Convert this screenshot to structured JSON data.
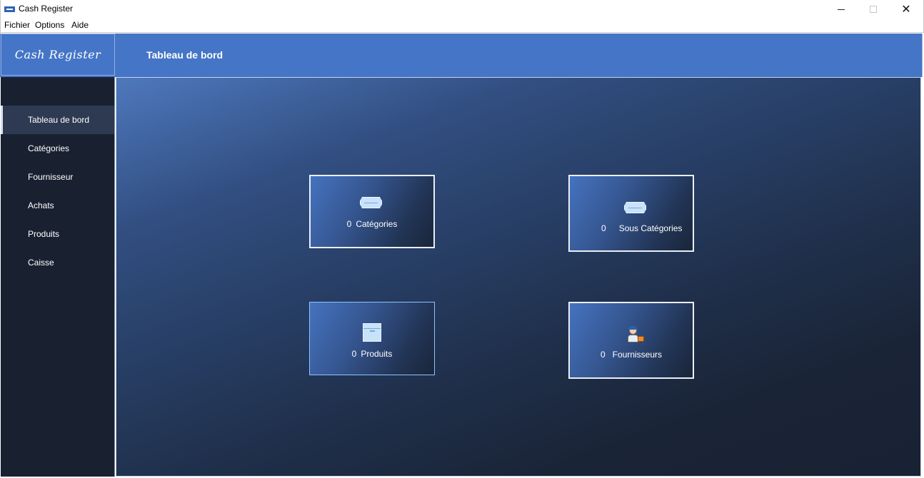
{
  "window": {
    "title": "Cash Register",
    "close_glyph": "✕"
  },
  "menu": [
    "Fichier",
    "Options",
    "Aide"
  ],
  "header": {
    "logo": "Cash Register",
    "page_title": "Tableau de bord"
  },
  "sidebar": {
    "items": [
      {
        "label": "Tableau de bord",
        "active": true
      },
      {
        "label": "Catégories"
      },
      {
        "label": "Fournisseur"
      },
      {
        "label": "Achats"
      },
      {
        "label": "Produits"
      },
      {
        "label": "Caisse"
      }
    ]
  },
  "tiles": {
    "categories": {
      "count": "0",
      "label": "Catégories",
      "icon": "ticket-icon"
    },
    "sous_categories": {
      "count": "0",
      "label": "Sous Catégories",
      "icon": "ticket-icon"
    },
    "produits": {
      "count": "0",
      "label": "Produits",
      "icon": "box-icon"
    },
    "fournisseurs": {
      "count": "0",
      "label": "Fournisseurs",
      "icon": "supplier-icon"
    }
  },
  "colors": {
    "header": "#4575c6",
    "sidebar": "#192131",
    "sidebar_active": "#2d3a52"
  }
}
